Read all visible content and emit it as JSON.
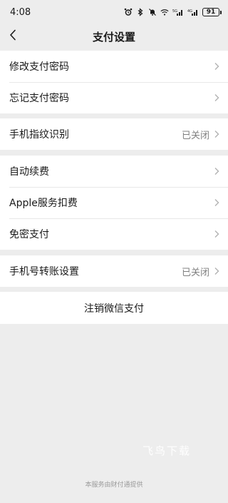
{
  "status_bar": {
    "time": "4:08",
    "icons": [
      "alarm-icon",
      "bluetooth-icon",
      "mute-icon",
      "wifi-icon",
      "signal-icon",
      "signal-icon"
    ],
    "signal_label_1": "5G",
    "signal_label_2": "4G",
    "battery": "91"
  },
  "nav": {
    "back_icon": "chevron-left-icon",
    "title": "支付设置"
  },
  "groups": [
    {
      "items": [
        {
          "label": "修改支付密码",
          "value": ""
        },
        {
          "label": "忘记支付密码",
          "value": ""
        }
      ]
    },
    {
      "items": [
        {
          "label": "手机指纹识别",
          "value": "已关闭"
        }
      ]
    },
    {
      "items": [
        {
          "label": "自动续费",
          "value": ""
        },
        {
          "label": "Apple服务扣费",
          "value": ""
        },
        {
          "label": "免密支付",
          "value": ""
        }
      ]
    },
    {
      "items": [
        {
          "label": "手机号转账设置",
          "value": "已关闭"
        }
      ]
    }
  ],
  "cancel_label": "注销微信支付",
  "watermark": "飞鸟下载",
  "footer": "本服务由财付通提供",
  "colors": {
    "background": "#ededed",
    "card": "#ffffff",
    "text": "#1a1a1a",
    "secondary_text": "#7f7f7f",
    "footer_text": "#9a9a9a"
  }
}
